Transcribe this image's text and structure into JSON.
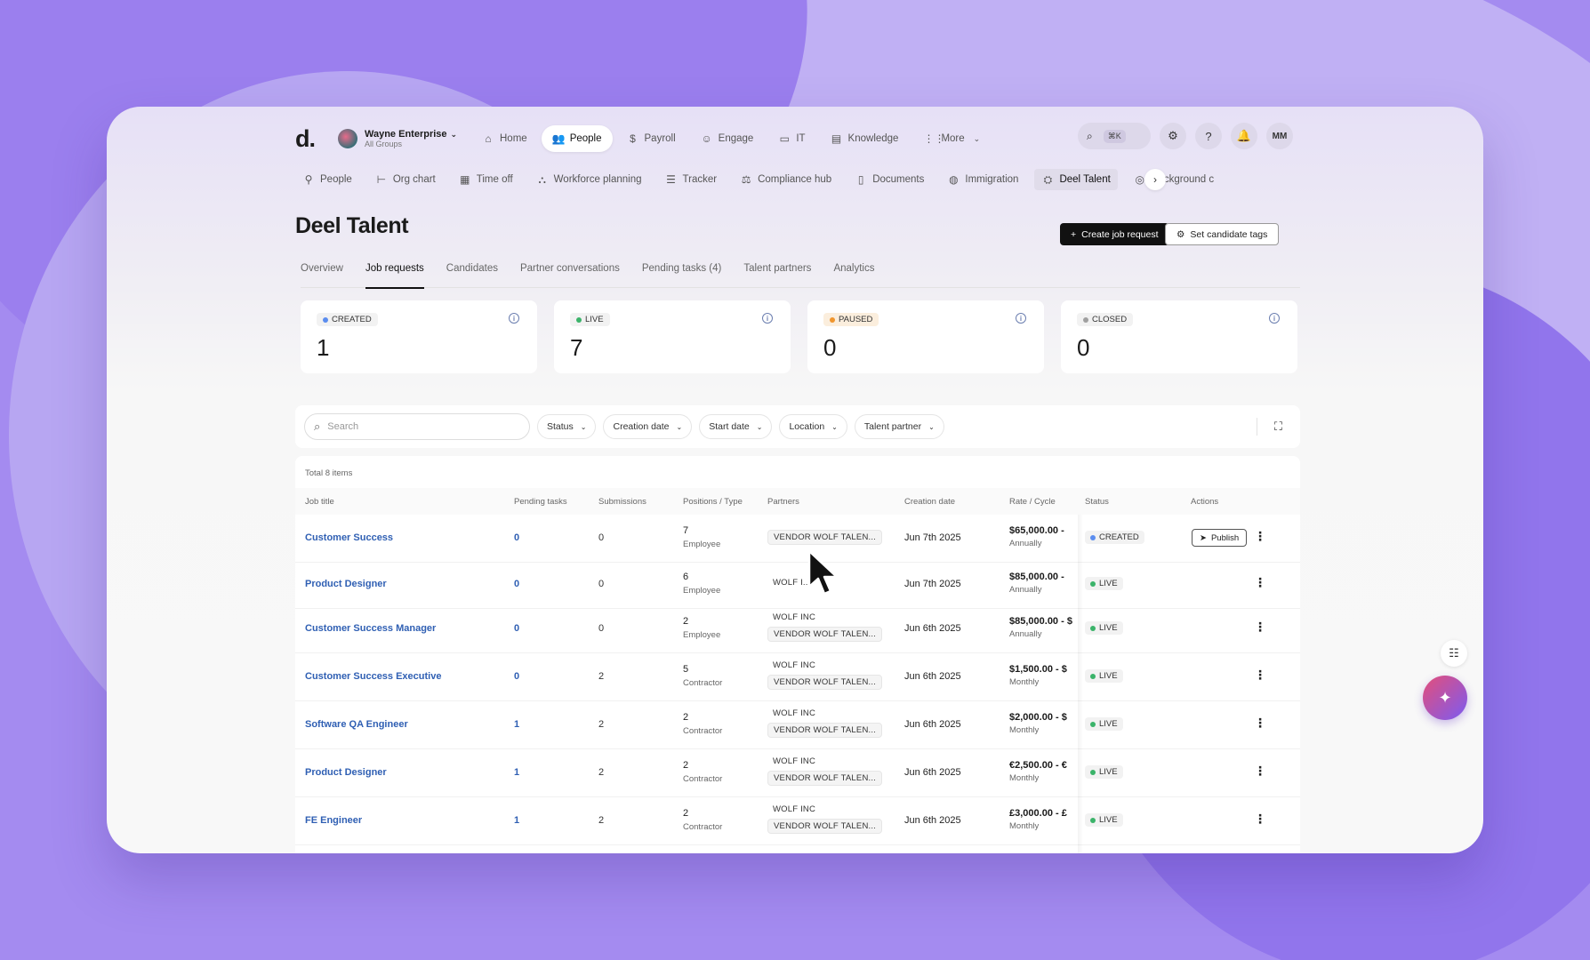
{
  "nav": {
    "logo": "d.",
    "org_name": "Wayne Enterprise",
    "org_sub": "All Groups",
    "items": [
      {
        "label": "Home",
        "icon": "home-icon",
        "active": false
      },
      {
        "label": "People",
        "icon": "people-icon",
        "active": true
      },
      {
        "label": "Payroll",
        "icon": "payroll-icon",
        "active": false
      },
      {
        "label": "Engage",
        "icon": "engage-icon",
        "active": false
      },
      {
        "label": "IT",
        "icon": "laptop-icon",
        "active": false
      },
      {
        "label": "Knowledge",
        "icon": "book-icon",
        "active": false
      },
      {
        "label": "More",
        "icon": "grid-icon",
        "active": false
      }
    ],
    "search_shortcut": "⌘K",
    "avatar": "MM"
  },
  "subnav": {
    "items": [
      {
        "label": "People"
      },
      {
        "label": "Org chart"
      },
      {
        "label": "Time off"
      },
      {
        "label": "Workforce planning"
      },
      {
        "label": "Tracker"
      },
      {
        "label": "Compliance hub"
      },
      {
        "label": "Documents"
      },
      {
        "label": "Immigration"
      },
      {
        "label": "Deel Talent"
      },
      {
        "label": "Background c"
      }
    ]
  },
  "page": {
    "title": "Deel Talent",
    "create_btn": "Create job request",
    "tags_btn": "Set candidate tags"
  },
  "tabs": [
    "Overview",
    "Job requests",
    "Candidates",
    "Partner conversations",
    "Pending tasks (4)",
    "Talent partners",
    "Analytics"
  ],
  "stats": [
    {
      "label": "CREATED",
      "value": "1",
      "color": "#5b8def"
    },
    {
      "label": "LIVE",
      "value": "7",
      "color": "#3bb36a"
    },
    {
      "label": "PAUSED",
      "value": "0",
      "color": "#f0962e"
    },
    {
      "label": "CLOSED",
      "value": "0",
      "color": "#a0a0a0"
    }
  ],
  "filters": {
    "search_placeholder": "Search",
    "items": [
      "Status",
      "Creation date",
      "Start date",
      "Location",
      "Talent partner"
    ]
  },
  "table": {
    "total": "Total 8 items",
    "headers": [
      "Job title",
      "Pending tasks",
      "Submissions",
      "Positions / Type",
      "Partners",
      "Creation date",
      "Rate / Cycle",
      "Status",
      "Actions"
    ],
    "publish_label": "Publish",
    "rows": [
      {
        "title": "Customer Success",
        "pending": "0",
        "subs": "0",
        "pos": "7",
        "type": "Employee",
        "partners": [
          "VENDOR WOLF TALEN..."
        ],
        "date": "Jun 7th 2025",
        "rate": "$65,000.00 -",
        "cycle": "Annually",
        "status": "CREATED",
        "publish": true
      },
      {
        "title": "Product Designer",
        "pending": "0",
        "subs": "0",
        "pos": "6",
        "type": "Employee",
        "partners": [
          "WOLF I..."
        ],
        "date": "Jun 7th 2025",
        "rate": "$85,000.00 -",
        "cycle": "Annually",
        "status": "LIVE",
        "publish": false
      },
      {
        "title": "Customer Success Manager",
        "pending": "0",
        "subs": "0",
        "pos": "2",
        "type": "Employee",
        "partners": [
          "WOLF INC",
          "VENDOR WOLF TALEN..."
        ],
        "date": "Jun 6th 2025",
        "rate": "$85,000.00 - $",
        "cycle": "Annually",
        "status": "LIVE",
        "publish": false
      },
      {
        "title": "Customer Success Executive",
        "pending": "0",
        "subs": "2",
        "pos": "5",
        "type": "Contractor",
        "partners": [
          "WOLF INC",
          "VENDOR WOLF TALEN..."
        ],
        "date": "Jun 6th 2025",
        "rate": "$1,500.00 - $",
        "cycle": "Monthly",
        "status": "LIVE",
        "publish": false
      },
      {
        "title": "Software QA Engineer",
        "pending": "1",
        "subs": "2",
        "pos": "2",
        "type": "Contractor",
        "partners": [
          "WOLF INC",
          "VENDOR WOLF TALEN..."
        ],
        "date": "Jun 6th 2025",
        "rate": "$2,000.00 - $",
        "cycle": "Monthly",
        "status": "LIVE",
        "publish": false
      },
      {
        "title": "Product Designer",
        "pending": "1",
        "subs": "2",
        "pos": "2",
        "type": "Contractor",
        "partners": [
          "WOLF INC",
          "VENDOR WOLF TALEN..."
        ],
        "date": "Jun 6th 2025",
        "rate": "€2,500.00 - €",
        "cycle": "Monthly",
        "status": "LIVE",
        "publish": false
      },
      {
        "title": "FE Engineer",
        "pending": "1",
        "subs": "2",
        "pos": "2",
        "type": "Contractor",
        "partners": [
          "WOLF INC",
          "VENDOR WOLF TALEN..."
        ],
        "date": "Jun 6th 2025",
        "rate": "£3,000.00 - £",
        "cycle": "Monthly",
        "status": "LIVE",
        "publish": false
      }
    ]
  }
}
